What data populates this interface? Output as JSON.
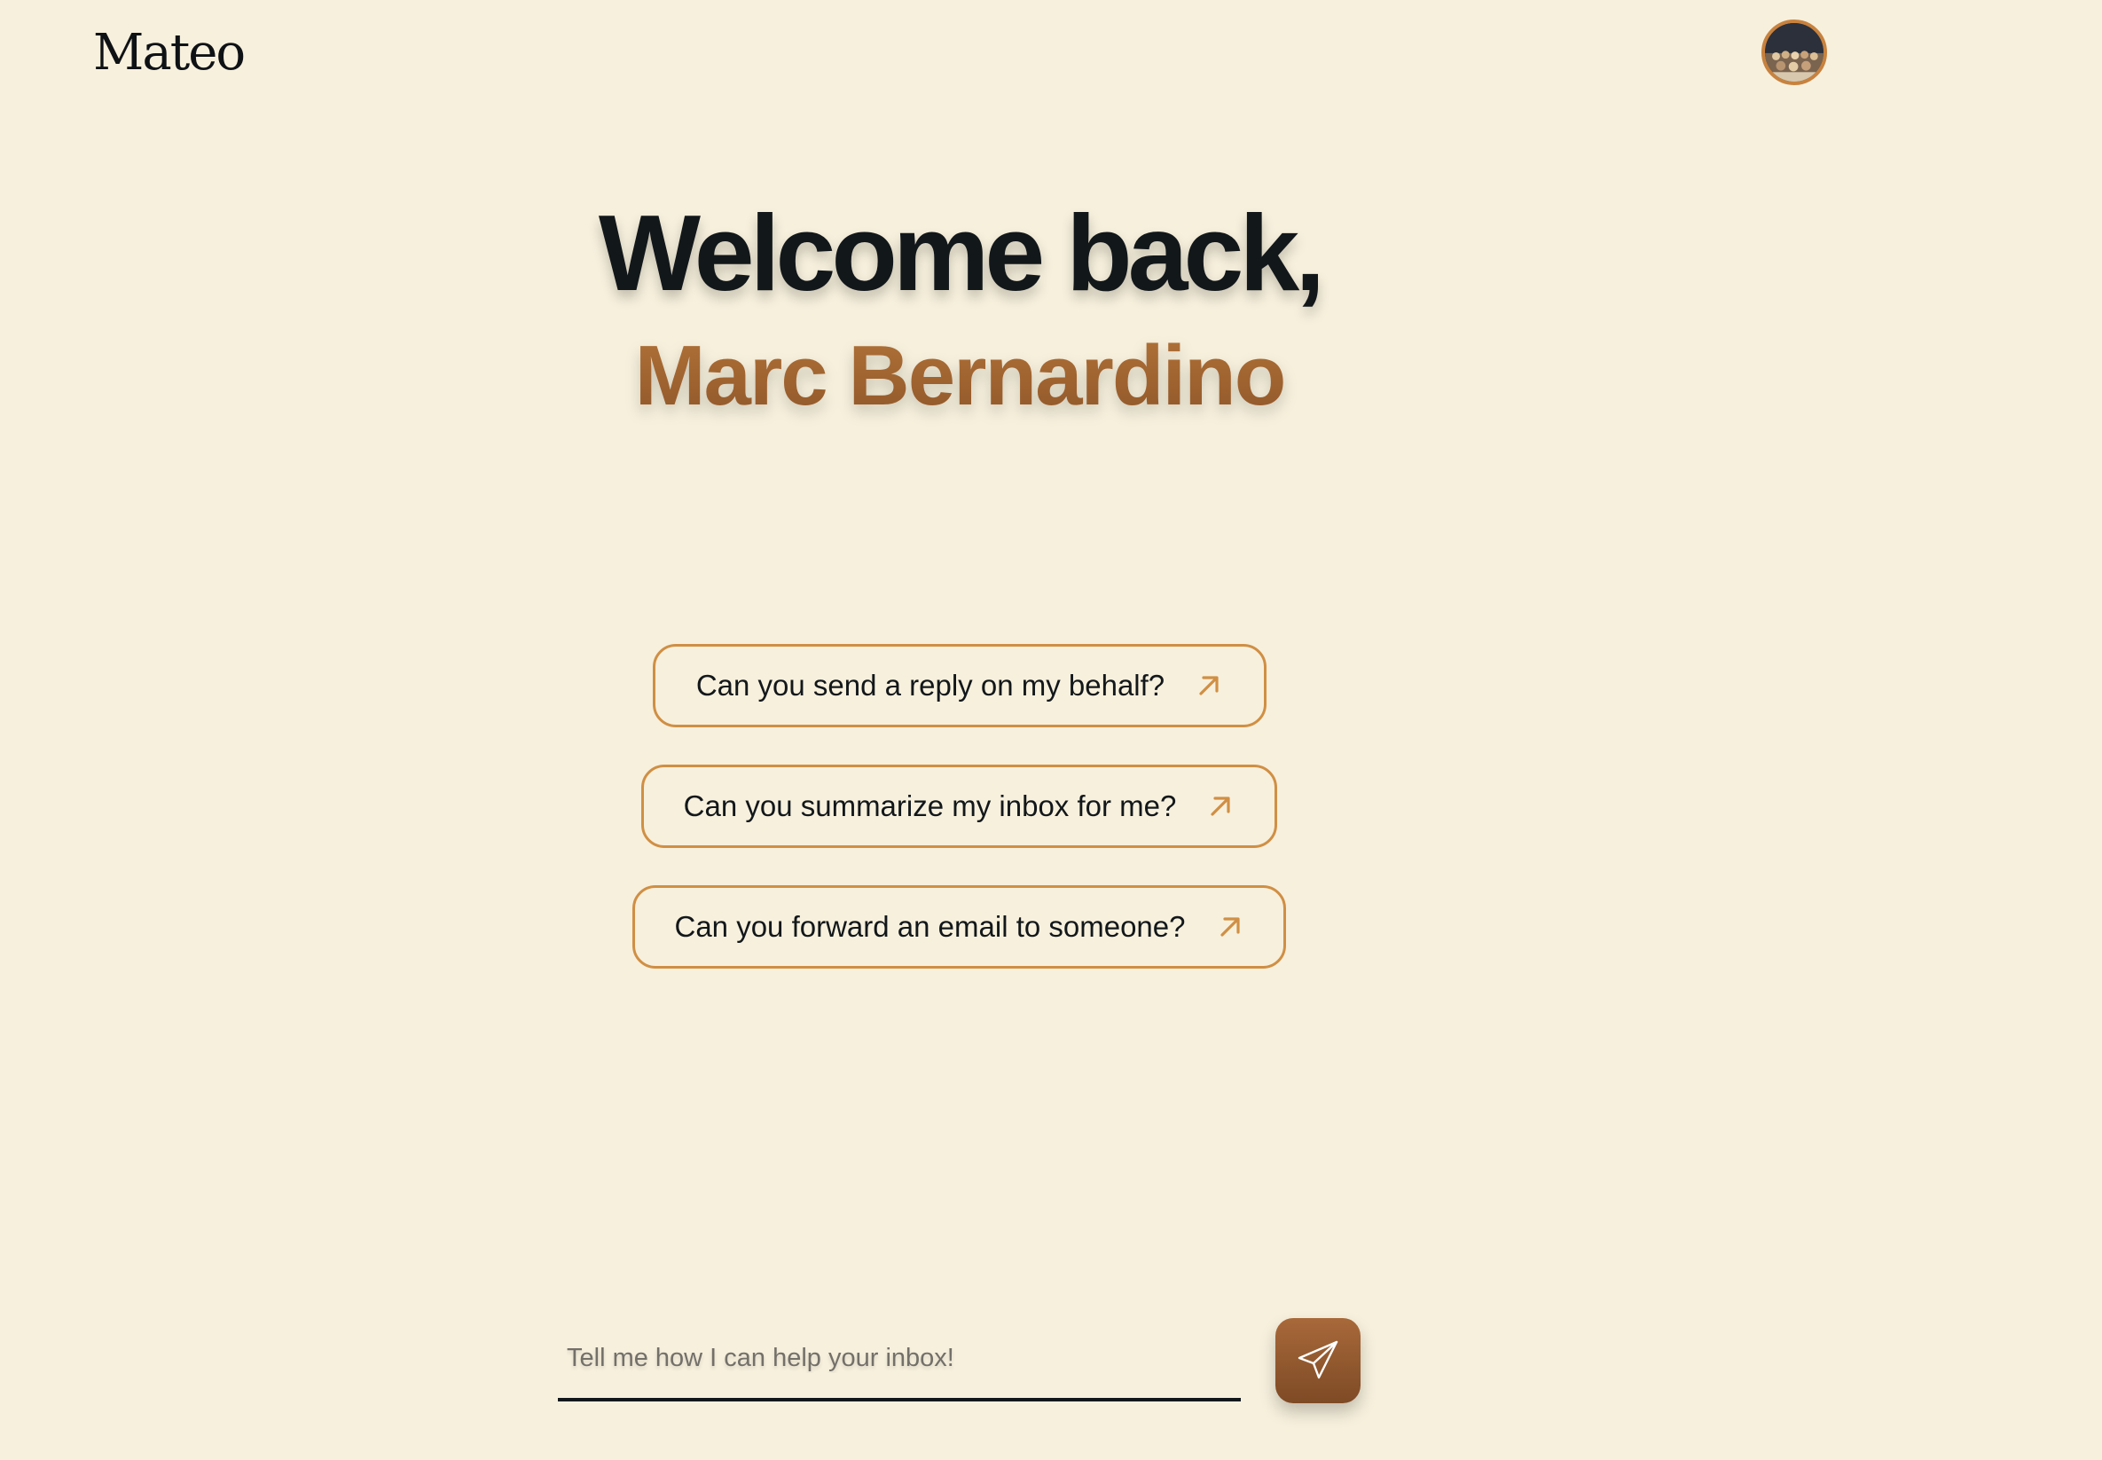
{
  "header": {
    "logo_text": "Mateo",
    "avatar_icon": "user-avatar"
  },
  "hero": {
    "greeting": "Welcome back,",
    "user_name": "Marc Bernardino"
  },
  "suggestions": [
    {
      "label": "Can you send a reply on my behalf?",
      "icon": "arrow-up-right-icon"
    },
    {
      "label": "Can you summarize my inbox for me?",
      "icon": "arrow-up-right-icon"
    },
    {
      "label": "Can you forward an email to someone?",
      "icon": "arrow-up-right-icon"
    }
  ],
  "composer": {
    "placeholder": "Tell me how I can help your inbox!",
    "value": "",
    "send_icon": "paper-plane-icon"
  },
  "colors": {
    "background": "#F7F0DD",
    "accent": "#D08F44",
    "brand_brown": "#9D622F",
    "text": "#12171A"
  }
}
